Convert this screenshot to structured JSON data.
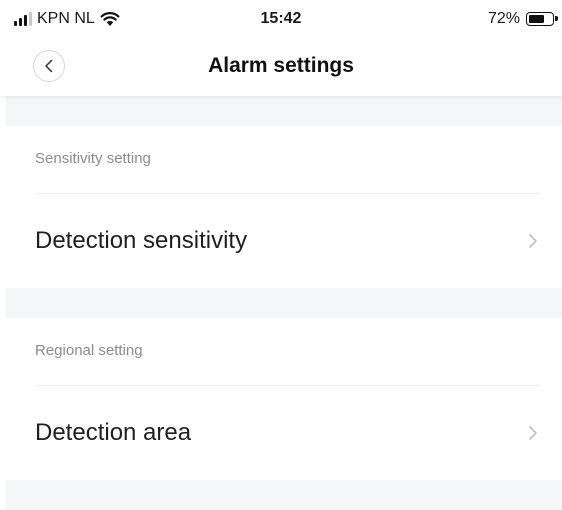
{
  "status_bar": {
    "carrier": "KPN NL",
    "time": "15:42",
    "battery": "72%",
    "battery_level": 0.72,
    "signal_icon": "cellular-signal-icon",
    "wifi_icon": "wifi-icon",
    "battery_icon": "battery-icon"
  },
  "header": {
    "title": "Alarm settings",
    "back_icon": "chevron-left-icon"
  },
  "sections": [
    {
      "header": "Sensitivity setting",
      "item": {
        "label": "Detection sensitivity",
        "icon": "chevron-right-icon"
      }
    },
    {
      "header": "Regional setting",
      "item": {
        "label": "Detection area",
        "icon": "chevron-right-icon"
      }
    }
  ],
  "colors": {
    "background": "#ffffff",
    "section_gap": "#f5f6f7",
    "section_header_text": "#8c8c8c",
    "item_text": "#1f1f1f",
    "chevron": "#c0c0c0"
  }
}
